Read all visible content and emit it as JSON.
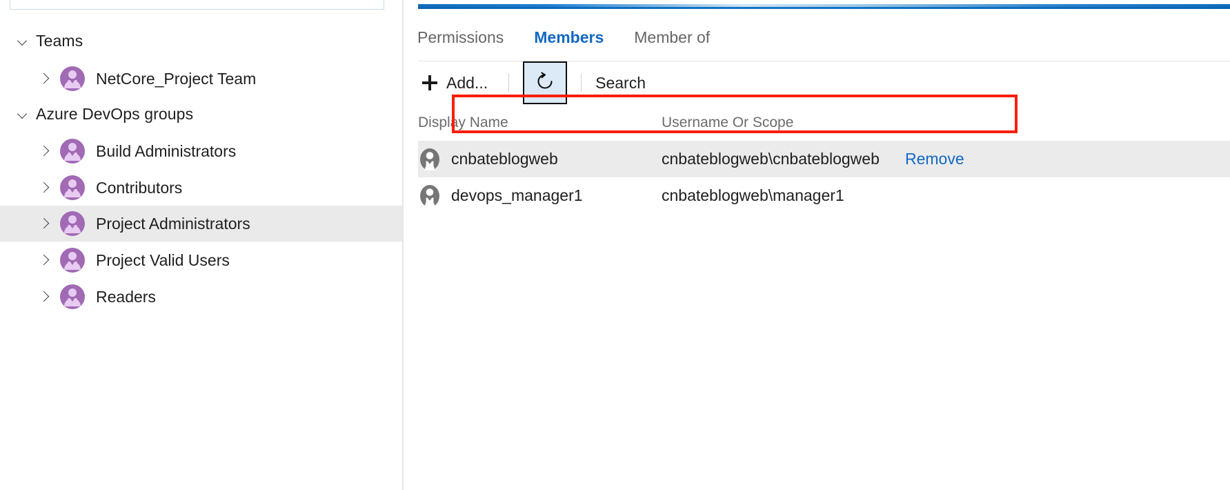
{
  "sidebar": {
    "search_box": {
      "name": "group-search-input",
      "value": "",
      "placeholder": ""
    },
    "groups": [
      {
        "label": "Teams",
        "expanded": true,
        "chevron": "chevron-down-icon",
        "items": [
          {
            "label": "NetCore_Project Team",
            "icon": "group-icon",
            "chevron": "chevron-right-icon",
            "selected": false
          }
        ]
      },
      {
        "label": "Azure DevOps groups",
        "expanded": true,
        "chevron": "chevron-down-icon",
        "items": [
          {
            "label": "Build Administrators",
            "icon": "group-icon",
            "chevron": "chevron-right-icon",
            "selected": false
          },
          {
            "label": "Contributors",
            "icon": "group-icon",
            "chevron": "chevron-right-icon",
            "selected": false
          },
          {
            "label": "Project Administrators",
            "icon": "group-icon",
            "chevron": "chevron-right-icon",
            "selected": true
          },
          {
            "label": "Project Valid Users",
            "icon": "group-icon",
            "chevron": "chevron-right-icon",
            "selected": false
          },
          {
            "label": "Readers",
            "icon": "group-icon",
            "chevron": "chevron-right-icon",
            "selected": false
          }
        ]
      }
    ]
  },
  "main": {
    "tabs": [
      {
        "label": "Permissions",
        "active": false
      },
      {
        "label": "Members",
        "active": true
      },
      {
        "label": "Member of",
        "active": false
      }
    ],
    "toolbar": {
      "add_label": "Add...",
      "add_icon": "plus-icon",
      "refresh_icon": "refresh-icon",
      "refresh_title": "Refresh",
      "search_label": "Search"
    },
    "table": {
      "columns": [
        "Display Name",
        "Username Or Scope"
      ],
      "action_column": "",
      "rows": [
        {
          "display_name": "cnbateblogweb",
          "username_or_scope": "cnbateblogweb\\cnbateblogweb",
          "action": "Remove",
          "avatar": "user-avatar-icon",
          "highlighted_row": true,
          "annotated": false
        },
        {
          "display_name": "devops_manager1",
          "username_or_scope": "cnbateblogweb\\manager1",
          "action": "",
          "avatar": "user-avatar-icon",
          "highlighted_row": false,
          "annotated": true
        }
      ]
    }
  },
  "annotation": {
    "type": "red-rectangle-highlight",
    "color": "#fc1d09",
    "target": "devops_manager1-row"
  },
  "colors": {
    "accent_blue": "#1268c3",
    "link_blue": "#1268c3",
    "group_icon_purple": "#8e5ca0",
    "group_icon_fill": "#e6c8ee",
    "selected_row_gray": "#eaeaea",
    "alt_row_gray": "#ebebeb",
    "annotation_red": "#fc1d09",
    "focus_button_bg": "#dceaf7"
  }
}
